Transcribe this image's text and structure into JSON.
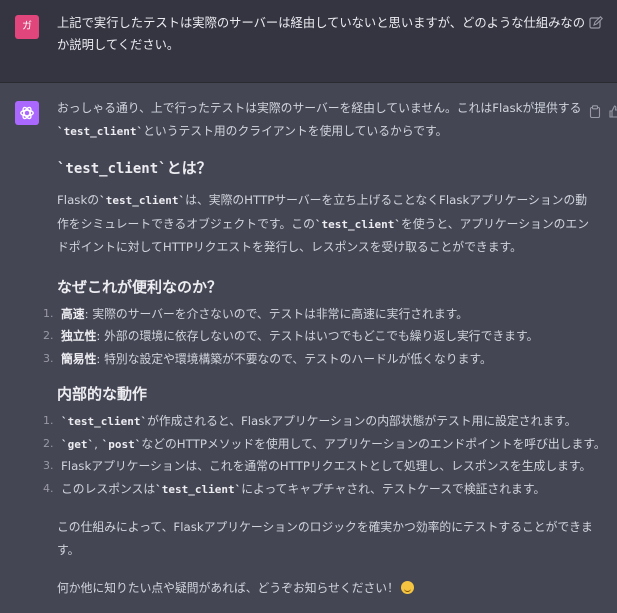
{
  "user": {
    "avatar_text": "ガ",
    "avatar_color": "#e0457b",
    "message": "上記で実行したテストは実際のサーバーは経由していないと思いますが、どのような仕組みなのか説明してください。"
  },
  "assistant": {
    "avatar_color": "#ab68ff",
    "intro_1": "おっしゃる通り、上で行ったテストは実際のサーバーを経由していません。これはFlaskが提供する",
    "intro_code": "`test_client`",
    "intro_2": "というテスト用のクライアントを使用しているからです。",
    "h1_code": "`test_client`",
    "h1_text": "とは？",
    "p2_1": "Flaskの",
    "p2_code1": "`test_client`",
    "p2_2": "は、実際のHTTPサーバーを立ち上げることなくFlaskアプリケーションの動作をシミュレートできるオブジェクトです。この",
    "p2_code2": "`test_client`",
    "p2_3": "を使うと、アプリケーションのエンドポイントに対してHTTPリクエストを発行し、レスポンスを受け取ることができます。",
    "h2": "なぜこれが便利なのか？",
    "list1": [
      {
        "num": "1.",
        "bold": "高速",
        "text": ": 実際のサーバーを介さないので、テストは非常に高速に実行されます。"
      },
      {
        "num": "2.",
        "bold": "独立性",
        "text": ": 外部の環境に依存しないので、テストはいつでもどこでも繰り返し実行できます。"
      },
      {
        "num": "3.",
        "bold": "簡易性",
        "text": ": 特別な設定や環境構築が不要なので、テストのハードルが低くなります。"
      }
    ],
    "h3": "内部的な動作",
    "list2": {
      "item1_num": "1.",
      "item1_code": "`test_client`",
      "item1_text": "が作成されると、Flaskアプリケーションの内部状態がテスト用に設定されます。",
      "item2_num": "2.",
      "item2_code1": "`get`",
      "item2_sep": ", ",
      "item2_code2": "`post`",
      "item2_text": "などのHTTPメソッドを使用して、アプリケーションのエンドポイントを呼び出します。",
      "item3_num": "3.",
      "item3_text": "Flaskアプリケーションは、これを通常のHTTPリクエストとして処理し、レスポンスを生成します。",
      "item4_num": "4.",
      "item4_text1": "このレスポンスは",
      "item4_code": "`test_client`",
      "item4_text2": "によってキャプチャされ、テストケースで検証されます。"
    },
    "p_end1": "この仕組みによって、Flaskアプリケーションのロジックを確実かつ効率的にテストすることができます。",
    "p_end2": "何か他に知りたい点や疑問があれば、どうぞお知らせください！",
    "emoji": "smile-emoji"
  },
  "icons": {
    "edit": "edit-icon",
    "copy": "clipboard-icon",
    "thumb": "thumbs-up-icon",
    "logo": "openai-logo-icon"
  }
}
